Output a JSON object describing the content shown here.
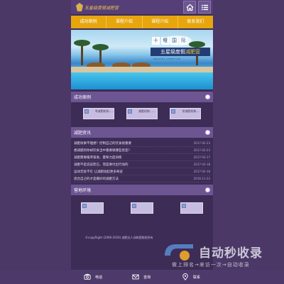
{
  "header": {
    "logo_text": "五星级度假减肥营",
    "home_icon": "home-icon",
    "menu_icon": "menu-icon"
  },
  "nav": [
    "成功案例",
    "课程介绍",
    "课程介绍",
    "联系我们"
  ],
  "banner": {
    "top_chars": [
      "十",
      "堰",
      "国",
      "际"
    ],
    "title_main": "五星级度假",
    "title_accent": "减肥营",
    "subtitle": "HEALTHY LIFESTYLE"
  },
  "sections": {
    "cases_title": "成功案例",
    "cases": [
      "寻减肥机构……",
      "减肥机构……",
      "学减肥机构……"
    ],
    "tips_title": "减肥资讯",
    "tips": [
      {
        "text": "减肥效果不理想？控制自己的饮食很重要",
        "date": "2017-02-23"
      },
      {
        "text": "想减肥的你却饮食当中重要很哪些优变？",
        "date": "2017-02-23"
      },
      {
        "text": "减肥需要循序渐进，量和力度训练",
        "date": "2017-03-17"
      },
      {
        "text": "减肥不是说说而已，而是要付出行动的",
        "date": "2017-03-18"
      },
      {
        "text": "运动无处不在 让减肥动起更多奇迹",
        "date": "2017-02-16"
      },
      {
        "text": "适合自己的才是最好的减肥方法",
        "date": "2016-11-22"
      }
    ],
    "env_title": "营地环境"
  },
  "footer": {
    "copyright": "©copyRight (2006-2016) 减肥达人训练营版权所有"
  },
  "watermark": {
    "brand": "自动秒收录",
    "slogan": "做上排名→来访一次→自动收录"
  },
  "bottombar": [
    {
      "icon": "phone-icon",
      "label": "电话"
    },
    {
      "icon": "mail-icon",
      "label": "咨询"
    },
    {
      "icon": "location-icon",
      "label": "联系"
    }
  ]
}
